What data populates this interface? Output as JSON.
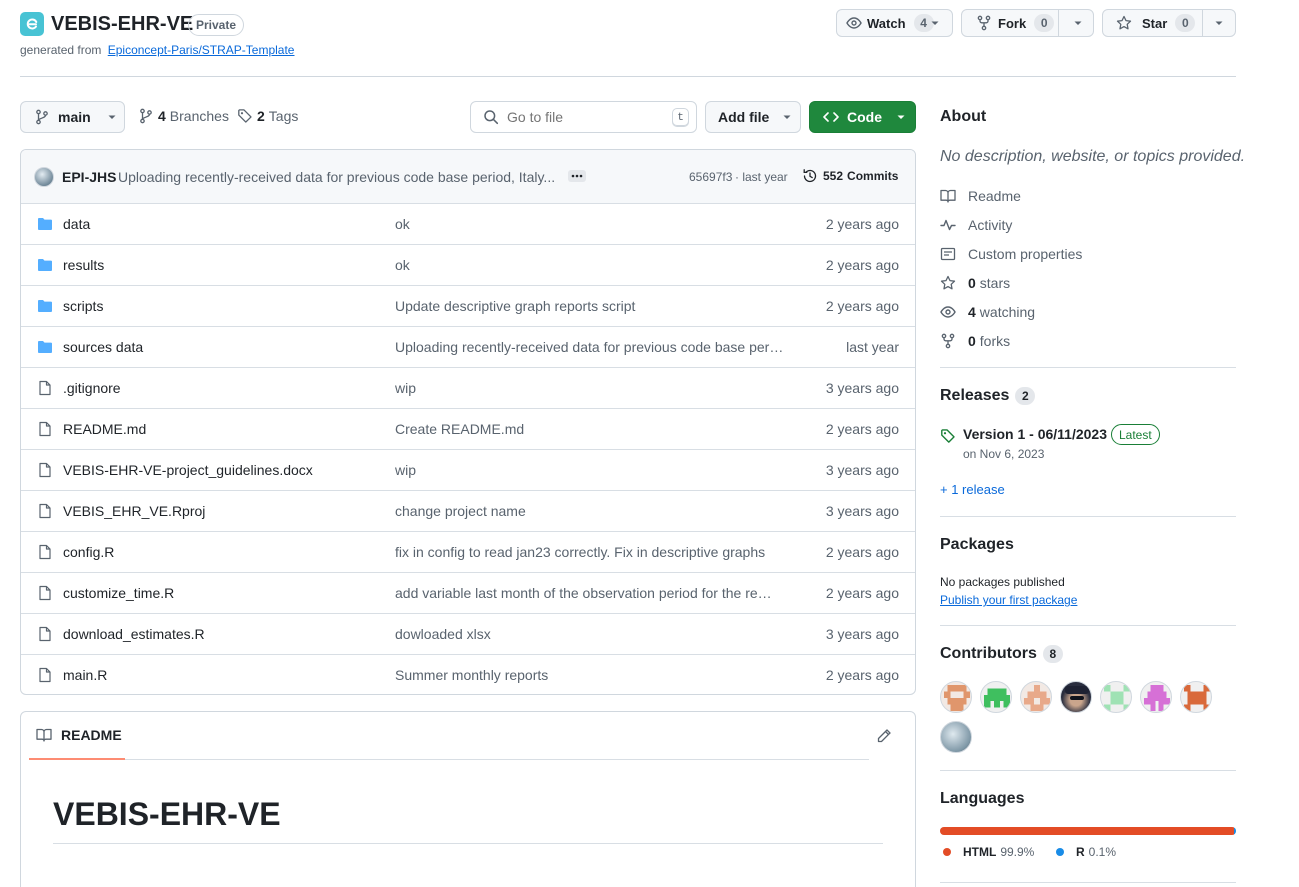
{
  "repo": {
    "name": "VEBIS-EHR-VE",
    "visibility": "Private",
    "generated_prefix": "generated from",
    "template_link": "Epiconcept-Paris/STRAP-Template"
  },
  "actions": {
    "watch_label": "Watch",
    "watch_count": "4",
    "fork_label": "Fork",
    "fork_count": "0",
    "star_label": "Star",
    "star_count": "0"
  },
  "toolbar": {
    "branch": "main",
    "branches_count": "4",
    "branches_label": "Branches",
    "tags_count": "2",
    "tags_label": "Tags",
    "search_placeholder": "Go to file",
    "search_shortcut": "t",
    "add_file_label": "Add file",
    "code_label": "Code"
  },
  "commit": {
    "author": "EPI-JHS",
    "message": "Uploading recently-received data for previous code base period, Italy...",
    "hash": "65697f3",
    "time": "· last year",
    "commits_count": "552",
    "commits_label": "Commits"
  },
  "files": [
    {
      "type": "dir",
      "name": "data",
      "message": "ok",
      "age": "2 years ago"
    },
    {
      "type": "dir",
      "name": "results",
      "message": "ok",
      "age": "2 years ago"
    },
    {
      "type": "dir",
      "name": "scripts",
      "message": "Update descriptive graph reports script",
      "age": "2 years ago"
    },
    {
      "type": "dir",
      "name": "sources data",
      "message": "Uploading recently-received data for previous code base period, Italy",
      "age": "last year"
    },
    {
      "type": "file",
      "name": ".gitignore",
      "message": "wip",
      "age": "3 years ago"
    },
    {
      "type": "file",
      "name": "README.md",
      "message": "Create README.md",
      "age": "2 years ago"
    },
    {
      "type": "file",
      "name": "VEBIS-EHR-VE-project_guidelines.docx",
      "message": "wip",
      "age": "3 years ago"
    },
    {
      "type": "file",
      "name": "VEBIS_EHR_VE.Rproj",
      "message": "change project name",
      "age": "3 years ago"
    },
    {
      "type": "file",
      "name": "config.R",
      "message": "fix in config to read jan23 correctly. Fix in descriptive graphs",
      "age": "2 years ago"
    },
    {
      "type": "file",
      "name": "customize_time.R",
      "message": "add variable last month of the observation period for the reports",
      "age": "2 years ago"
    },
    {
      "type": "file",
      "name": "download_estimates.R",
      "message": "dowloaded xlsx",
      "age": "3 years ago"
    },
    {
      "type": "file",
      "name": "main.R",
      "message": "Summer monthly reports",
      "age": "2 years ago"
    }
  ],
  "readme": {
    "tab_label": "README",
    "heading": "VEBIS-EHR-VE"
  },
  "about": {
    "title": "About",
    "description": "No description, website, or topics provided.",
    "readme_label": "Readme",
    "activity_label": "Activity",
    "custom_props_label": "Custom properties",
    "stars_count": "0",
    "stars_label": "stars",
    "watching_count": "4",
    "watching_label": "watching",
    "forks_count": "0",
    "forks_label": "forks"
  },
  "releases": {
    "title": "Releases",
    "count": "2",
    "latest_name": "Version 1 - 06/11/2023",
    "latest_badge": "Latest",
    "latest_date": "on Nov 6, 2023",
    "more_link": "+ 1 release"
  },
  "packages": {
    "title": "Packages",
    "none_text": "No packages published",
    "publish_link": "Publish your first package"
  },
  "contributors": {
    "title": "Contributors",
    "count": "8"
  },
  "languages": {
    "title": "Languages",
    "items": [
      {
        "name": "HTML",
        "percent": "99.9%",
        "value": 99.9,
        "color": "#e34c26"
      },
      {
        "name": "R",
        "percent": "0.1%",
        "value": 0.1,
        "color": "#198ce7"
      }
    ]
  },
  "colors": {
    "accent_green": "#1f883d",
    "link_blue": "#0969da",
    "folder_blue": "#54aeff",
    "latest_green": "#1a7f37"
  }
}
